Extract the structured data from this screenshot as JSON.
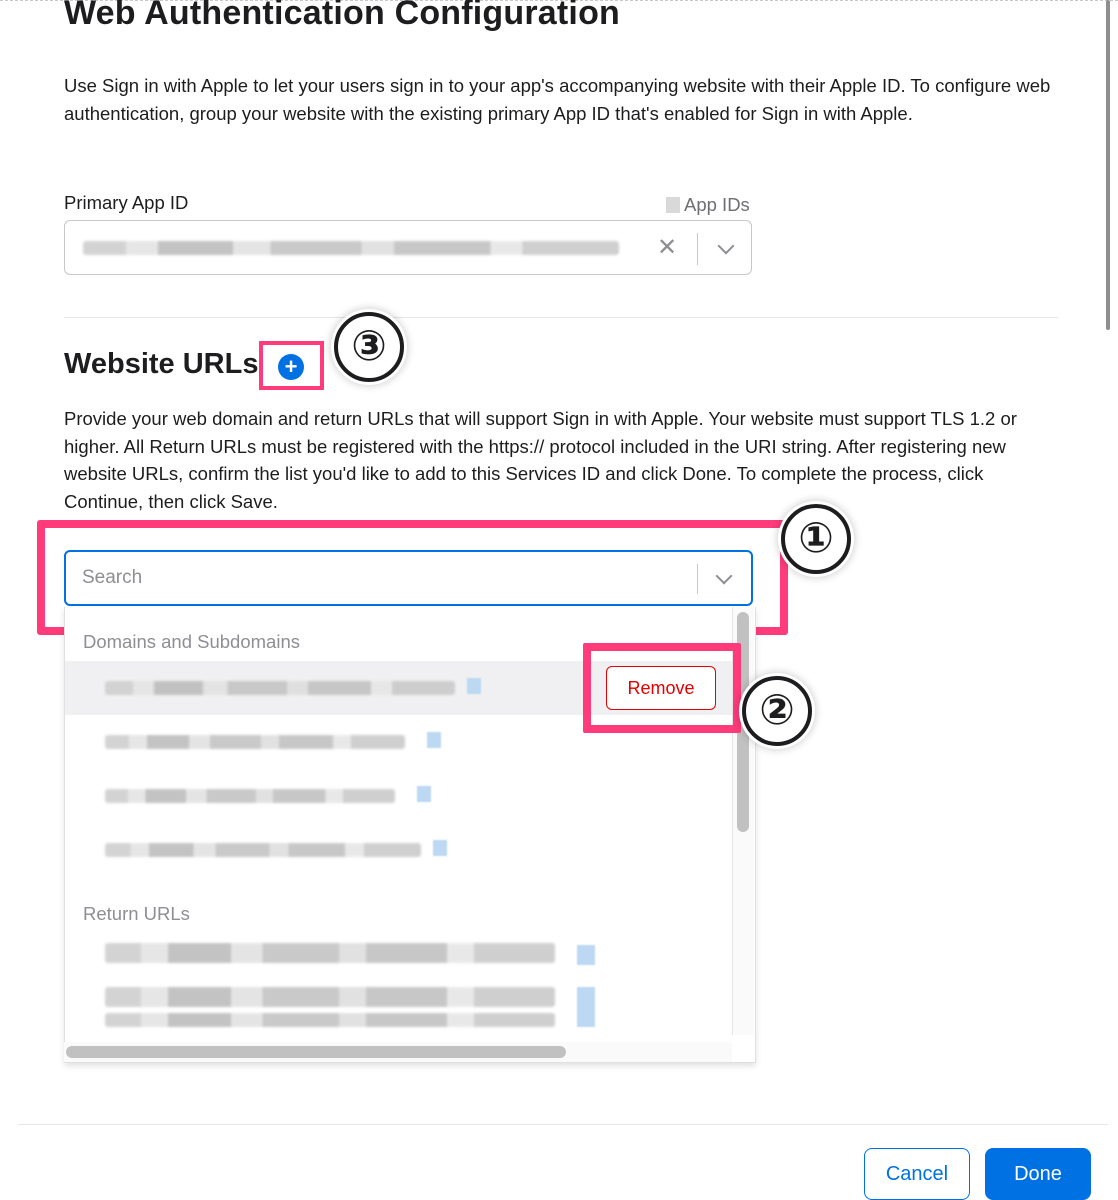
{
  "page": {
    "title": "Web Authentication Configuration",
    "description": "Use Sign in with Apple to let your users sign in to your app's accompanying website with their Apple ID. To configure web authentication, group your website with the existing primary App ID that's enabled for Sign in with Apple."
  },
  "primary_app_id": {
    "label": "Primary App ID",
    "link_label": "App IDs",
    "value": ""
  },
  "website_urls": {
    "heading": "Website URLs",
    "description": "Provide your web domain and return URLs that will support Sign in with Apple. Your website must support TLS 1.2 or higher. All Return URLs must be registered with the https:// protocol included in the URI string. After registering new website URLs, confirm the list you'd like to add to this Services ID and click Done. To complete the process, click Continue, then click Save.",
    "search_placeholder": "Search",
    "groups": {
      "domains_label": "Domains and Subdomains",
      "return_urls_label": "Return URLs"
    },
    "remove_label": "Remove"
  },
  "annotations": {
    "step1": "①",
    "step2": "②",
    "step3": "③",
    "highlight_color": "#ff3b7b"
  },
  "footer": {
    "cancel_label": "Cancel",
    "done_label": "Done"
  },
  "colors": {
    "accent": "#0071e3",
    "danger": "#e30000",
    "text": "#1d1d1f",
    "secondary_text": "#8e8e93"
  },
  "icons": {
    "plus": "plus-circle-icon",
    "clear": "clear-x-icon",
    "chevron": "chevron-down-icon"
  }
}
